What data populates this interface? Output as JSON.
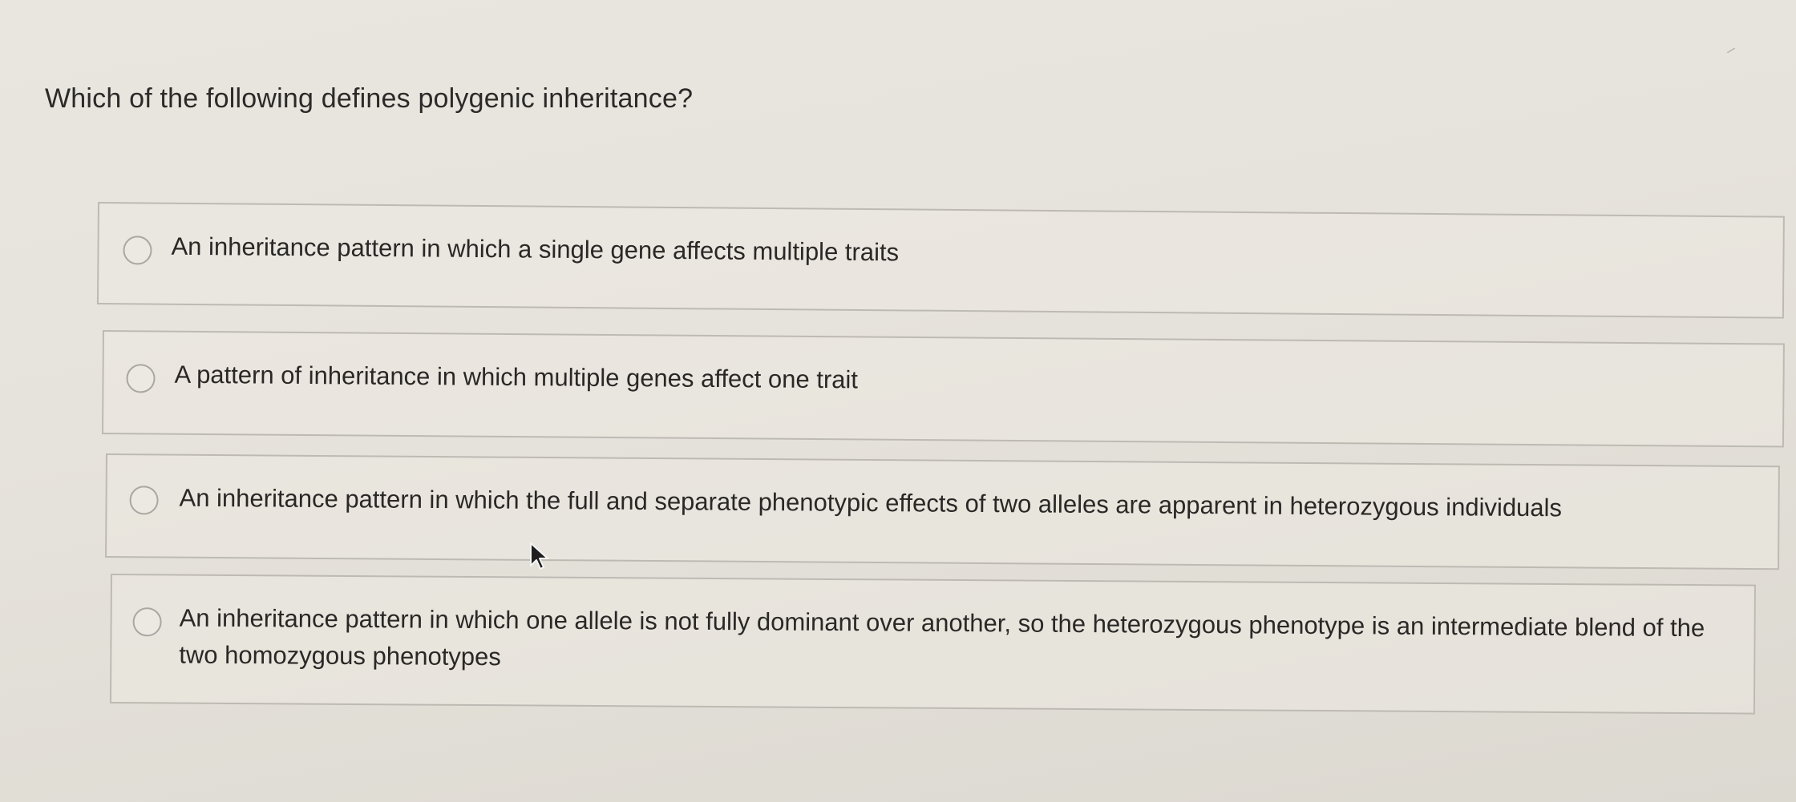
{
  "question": {
    "text": "Which of the following defines polygenic inheritance?"
  },
  "options": [
    {
      "label": "An inheritance pattern in which a single gene affects multiple traits",
      "selected": false
    },
    {
      "label": "A pattern of inheritance in which multiple genes affect one trait",
      "selected": false
    },
    {
      "label": "An inheritance pattern in which the full and separate phenotypic effects of two alleles are apparent in heterozygous individuals",
      "selected": false
    },
    {
      "label": "An inheritance pattern in which one allele is not fully dominant over another, so the heterozygous phenotype is an intermediate blend of the two homozygous phenotypes",
      "selected": false
    }
  ],
  "icons": {
    "radio": "radio-unchecked-icon",
    "cursor": "mouse-pointer-icon"
  },
  "colors": {
    "background": "#e7e4dd",
    "text": "#2a2826",
    "border": "#bdbab3"
  }
}
